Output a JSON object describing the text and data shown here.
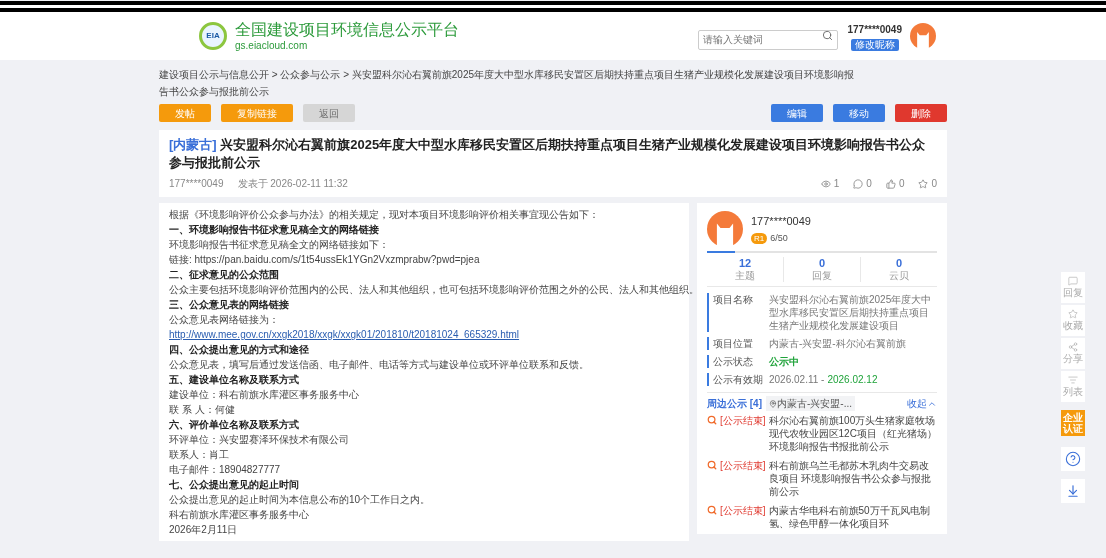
{
  "header": {
    "logo_text": "EIA",
    "site_title": "全国建设项目环境信息公示平台",
    "site_url": "gs.eiacloud.com",
    "search": {
      "placeholder": "请输入关键词"
    },
    "user": {
      "name": "177****0049",
      "rename_button": "修改昵称"
    }
  },
  "breadcrumb": {
    "separator": ">",
    "items": [
      "建设项目公示与信息公开",
      "公众参与公示",
      "兴安盟科尔沁右翼前旗2025年度大中型水库移民安置区后期扶持重点项目生猪产业规模化发展建设项目环境影响报告书公众参与报批前公示"
    ]
  },
  "actions_left": [
    {
      "label": "发帖",
      "color": "#f59a0c",
      "disabled": false
    },
    {
      "label": "复制链接",
      "color": "#f59a0c",
      "disabled": false
    },
    {
      "label": "返回",
      "color": "#d6d6d6",
      "disabled": true
    }
  ],
  "actions_right": [
    {
      "label": "编辑",
      "color": "#3a7be0",
      "disabled": false
    },
    {
      "label": "移动",
      "color": "#3a7be0",
      "disabled": false
    },
    {
      "label": "删除",
      "color": "#e0382e",
      "disabled": false
    }
  ],
  "post": {
    "region": "[内蒙古]",
    "title": "兴安盟科尔沁右翼前旗2025年度大中型水库移民安置区后期扶持重点项目生猪产业规模化发展建设项目环境影响报告书公众参与报批前公示",
    "author": "177****0049",
    "posted": "发表于 2026-02-11 11:32",
    "views": "1",
    "comments": "0",
    "likes": "0",
    "favorites": "0"
  },
  "body": [
    {
      "kind": "text",
      "text": "根据《环境影响评价公众参与办法》的相关规定，现对本项目环境影响评价相关事宜现公告如下："
    },
    {
      "kind": "heading",
      "text": "一、环境影响报告书征求意见稿全文的网络链接"
    },
    {
      "kind": "text",
      "text": "环境影响报告书征求意见稿全文的网络链接如下："
    },
    {
      "kind": "text",
      "text": "链接: https://pan.baidu.com/s/1t54ussEk1YGn2Vxzmprabw?pwd=pjea"
    },
    {
      "kind": "heading",
      "text": "二、征求意见的公众范围"
    },
    {
      "kind": "text",
      "text": "公众主要包括环境影响评价范围内的公民、法人和其他组织，也可包括环境影响评价范围之外的公民、法人和其他组织。"
    },
    {
      "kind": "heading",
      "text": "三、公众意见表的网络链接"
    },
    {
      "kind": "text",
      "text": "公众意见表网络链接为："
    },
    {
      "kind": "link",
      "text": "http://www.mee.gov.cn/xxgk2018/xxgk/xxgk01/201810/t20181024_665329.html"
    },
    {
      "kind": "heading",
      "text": "四、公众提出意见的方式和途径"
    },
    {
      "kind": "text",
      "text": "公众意见表，填写后通过发送信函、电子邮件、电话等方式与建设单位或环评单位联系和反馈。"
    },
    {
      "kind": "heading",
      "text": "五、建设单位名称及联系方式"
    },
    {
      "kind": "text",
      "text": "建设单位：科右前旗水库灌区事务服务中心"
    },
    {
      "kind": "text",
      "text": "联 系 人：何健"
    },
    {
      "kind": "heading",
      "text": "六、评价单位名称及联系方式"
    },
    {
      "kind": "text",
      "text": "环评单位：兴安盟赛泽环保技术有限公司"
    },
    {
      "kind": "text",
      "text": "联系人：肖工"
    },
    {
      "kind": "text",
      "text": "电子邮件：18904827777"
    },
    {
      "kind": "heading",
      "text": "七、公众提出意见的起止时间"
    },
    {
      "kind": "text",
      "text": "公众提出意见的起止时间为本信息公布的10个工作日之内。"
    },
    {
      "kind": "text",
      "text": "科右前旗水库灌区事务服务中心"
    },
    {
      "kind": "text",
      "text": "2026年2月11日"
    }
  ],
  "profile": {
    "name": "177****0049",
    "rank": "R1",
    "points": "6/50",
    "level": 0.12,
    "stats": [
      {
        "value": "12",
        "label": "主题"
      },
      {
        "value": "0",
        "label": "回复"
      },
      {
        "value": "0",
        "label": "云贝"
      }
    ]
  },
  "project_info": [
    {
      "label": "项目名称",
      "value": "兴安盟科尔沁右翼前旗2025年度大中型水库移民安置区后期扶持重点项目生猪产业规模化发展建设项目",
      "kind": "plain"
    },
    {
      "label": "项目位置",
      "value": "内蒙古-兴安盟-科尔沁右翼前旗",
      "kind": "plain"
    },
    {
      "label": "公示状态",
      "value": "公示中",
      "kind": "status"
    },
    {
      "label": "公示有效期",
      "value": "2026.02.11 -",
      "value_end": "2026.02.12",
      "kind": "range"
    }
  ],
  "nearby": {
    "title": "周边公示 [4]",
    "location": "内蒙古-兴安盟-...",
    "collapse": "收起",
    "items": [
      {
        "tag": "[公示结束]",
        "text": "科尔沁右翼前旗100万头生猪家庭牧场现代农牧业园区12C项目（红光猪场）环境影响报告书报批前公示"
      },
      {
        "tag": "[公示结束]",
        "text": "科右前旗乌兰毛都苏木乳肉牛交易改良项目 环境影响报告书公众参与报批前公示"
      },
      {
        "tag": "[公示结束]",
        "text": "内蒙古华电科右前旗50万千瓦风电制氢、绿色甲醇一体化项目环"
      }
    ]
  },
  "side_tools": [
    {
      "kind": "reply",
      "label": "回复"
    },
    {
      "kind": "favorite",
      "label": "收藏"
    },
    {
      "kind": "share",
      "label": "分享"
    },
    {
      "kind": "list",
      "label": "列表"
    },
    {
      "kind": "certify",
      "label": "企业认证"
    },
    {
      "kind": "help"
    },
    {
      "kind": "download"
    }
  ]
}
